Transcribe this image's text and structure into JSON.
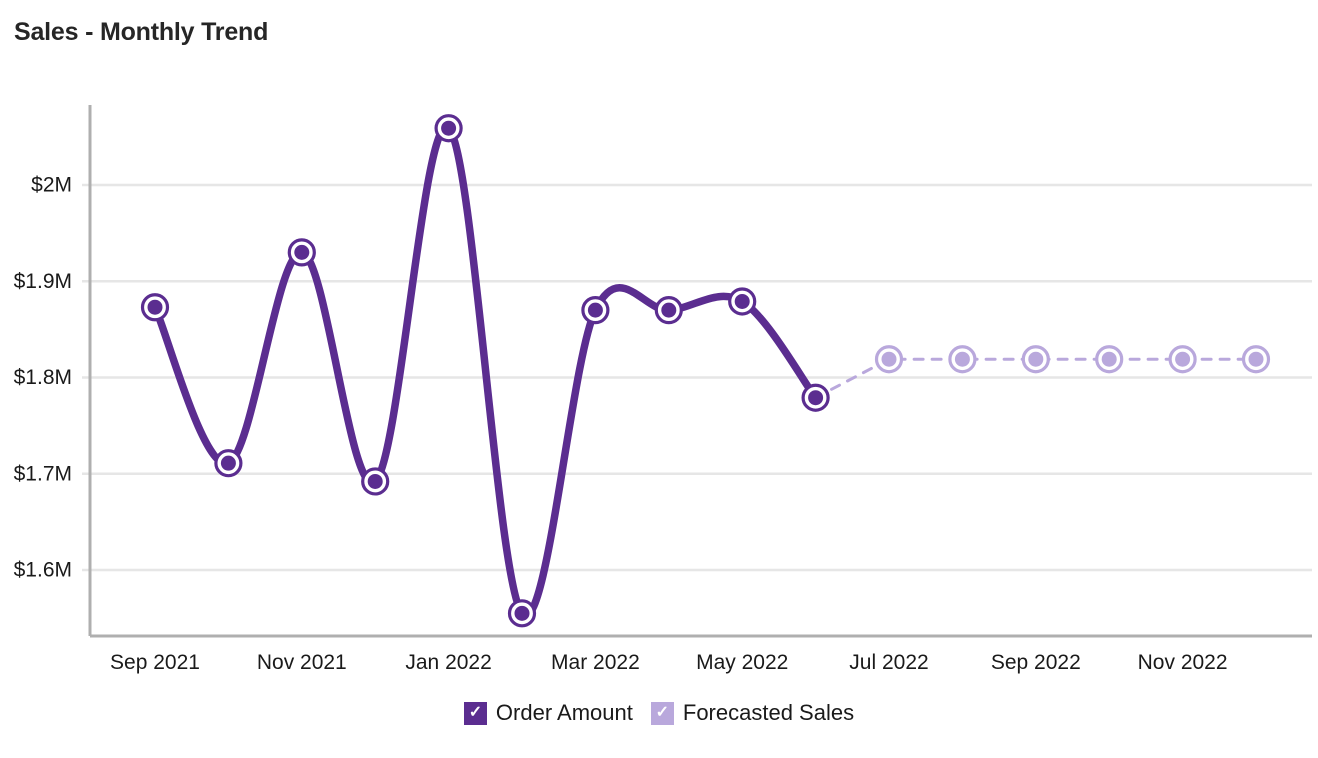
{
  "header": {
    "title": "Sales - Monthly Trend"
  },
  "legend": {
    "items": [
      {
        "label": "Order Amount",
        "color": "#5B2D90",
        "check": "✓",
        "checked": true
      },
      {
        "label": "Forecasted Sales",
        "color": "#B9A8DC",
        "check": "✓",
        "checked": true
      }
    ]
  },
  "colors": {
    "actual": "#5B2D90",
    "forecast": "#B9A8DC",
    "axis": "#AFAFAF",
    "grid": "#E6E6E6",
    "text": "#1a1a1a",
    "background": "#FFFFFF"
  },
  "chart_data": {
    "type": "line",
    "title": "Sales - Monthly Trend",
    "xlabel": "",
    "ylabel": "",
    "grid": true,
    "legend_position": "bottom",
    "ylim": [
      1.545,
      2.07
    ],
    "ytick_values": [
      2.0,
      1.9,
      1.8,
      1.7,
      1.6
    ],
    "ytick_labels": [
      "$2M",
      "$1.9M",
      "$1.8M",
      "$1.7M",
      "$1.6M"
    ],
    "xtick_labels": [
      "Sep 2021",
      "Nov 2021",
      "Jan 2022",
      "Mar 2022",
      "May 2022",
      "Jul 2022",
      "Sep 2022",
      "Nov 2022"
    ],
    "x": [
      "Sep 2021",
      "Oct 2021",
      "Nov 2021",
      "Dec 2021",
      "Jan 2022",
      "Feb 2022",
      "Mar 2022",
      "Apr 2022",
      "May 2022",
      "Jun 2022",
      "Jul 2022",
      "Aug 2022",
      "Sep 2022",
      "Oct 2022",
      "Nov 2022",
      "Dec 2022"
    ],
    "series": [
      {
        "name": "Order Amount",
        "style": "solid",
        "color": "#5B2D90",
        "values": [
          1.873,
          1.711,
          1.93,
          1.692,
          2.059,
          1.555,
          1.87,
          1.87,
          1.879,
          1.779,
          null,
          null,
          null,
          null,
          null,
          null
        ]
      },
      {
        "name": "Forecasted Sales",
        "style": "dashed",
        "color": "#B9A8DC",
        "values": [
          null,
          null,
          null,
          null,
          null,
          null,
          null,
          null,
          null,
          1.779,
          1.819,
          1.819,
          1.819,
          1.819,
          1.819,
          1.819
        ]
      }
    ],
    "units": "millions USD"
  }
}
